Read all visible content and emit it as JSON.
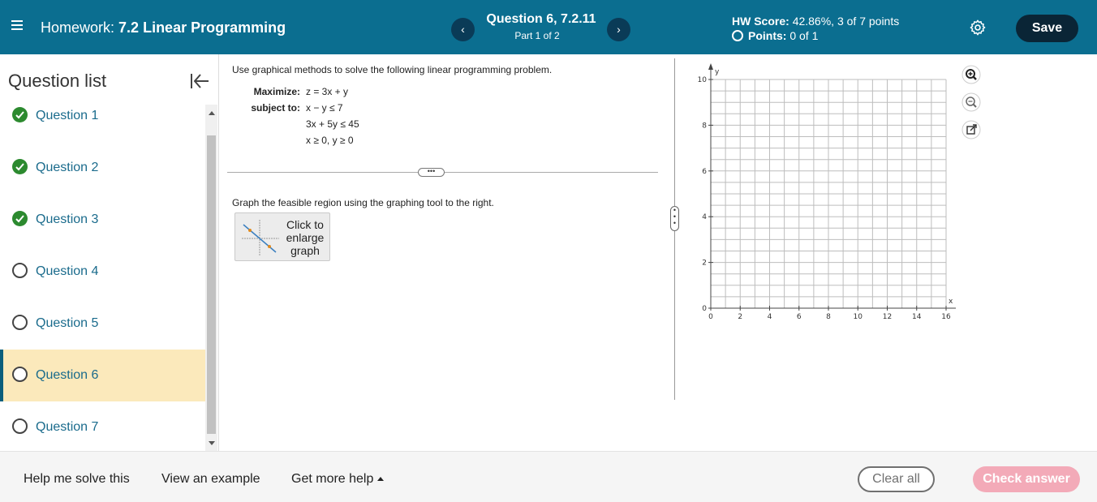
{
  "header": {
    "hw_prefix": "Homework:",
    "hw_name": "7.2 Linear Programming",
    "question_title": "Question 6, 7.2.11",
    "question_part": "Part 1 of 2",
    "prev_icon": "‹",
    "next_icon": "›",
    "score_label": "HW Score:",
    "score_value": "42.86%, 3 of 7 points",
    "points_label": "Points:",
    "points_value": "0 of 1",
    "save_label": "Save",
    "accent_color": "#0b6e90"
  },
  "sidebar": {
    "title": "Question list",
    "items": [
      {
        "label": "Question 1",
        "status": "done"
      },
      {
        "label": "Question 2",
        "status": "done"
      },
      {
        "label": "Question 3",
        "status": "done"
      },
      {
        "label": "Question 4",
        "status": "open"
      },
      {
        "label": "Question 5",
        "status": "open"
      },
      {
        "label": "Question 6",
        "status": "open",
        "active": true
      },
      {
        "label": "Question 7",
        "status": "open"
      }
    ]
  },
  "problem": {
    "intro": "Use graphical methods to solve the following linear programming problem.",
    "maximize_label": "Maximize:",
    "objective": "z = 3x + y",
    "subject_label": "subject to:",
    "constraints": [
      "x − y ≤ 7",
      "3x + 5y ≤ 45",
      "x ≥ 0, y ≥ 0"
    ],
    "instruction": "Graph the feasible region using the graphing tool to the right.",
    "enlarge_text": "Click to enlarge graph",
    "more_dots": "•••"
  },
  "graph": {
    "x_label": "x",
    "y_label": "y",
    "x_ticks": [
      "0",
      "2",
      "4",
      "6",
      "8",
      "10",
      "12",
      "14",
      "16"
    ],
    "y_ticks": [
      "0",
      "2",
      "4",
      "6",
      "8",
      "10"
    ],
    "x_range": [
      0,
      16
    ],
    "y_range": [
      0,
      10
    ],
    "grid": true,
    "tools": [
      "zoom-in-icon",
      "zoom-out-icon",
      "external-link-icon"
    ]
  },
  "footer": {
    "help_solve": "Help me solve this",
    "view_example": "View an example",
    "more_help": "Get more help",
    "clear_all": "Clear all",
    "check_answer": "Check answer"
  }
}
